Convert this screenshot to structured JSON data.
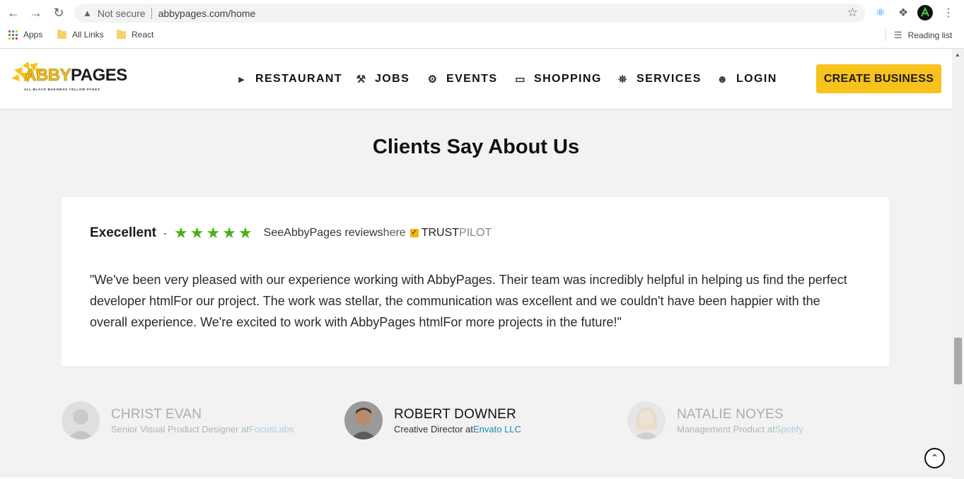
{
  "browser": {
    "security_label": "Not secure",
    "url": "abbypages.com/home",
    "bookmarks": [
      "Apps",
      "All Links",
      "React"
    ],
    "reading_list": "Reading list"
  },
  "brand": {
    "name_part1": "ABBY",
    "name_part2": "PAGES",
    "tagline": "ALL BLACK BUSINESS YELLOW PAGES",
    "accent_color": "#f7c21b"
  },
  "nav": {
    "items": [
      {
        "label": "RESTAURANT",
        "icon": "restaurant-icon"
      },
      {
        "label": "JOBS",
        "icon": "jobs-icon"
      },
      {
        "label": "EVENTS",
        "icon": "events-icon"
      },
      {
        "label": "SHOPPING",
        "icon": "shopping-icon"
      },
      {
        "label": "SERVICES",
        "icon": "services-icon"
      },
      {
        "label": "LOGIN",
        "icon": "user-icon"
      }
    ],
    "cta_label": "CREATE BUSINESS"
  },
  "testimonials": {
    "title": "Clients Say About Us",
    "rating_word": "Execellent",
    "rating_dash": "-",
    "stars": 5,
    "star_color": "#4caf1a",
    "see_prefix": "See",
    "see_brand": "AbbyPages",
    "see_reviews": " reviews",
    "see_here": "here",
    "trustpilot_part1": "TRUST",
    "trustpilot_part2": "PILOT",
    "quote": "\"We've been very pleased with our experience working with AbbyPages. Their team was incredibly helpful in helping us find the perfect developer htmlFor our project. The work was stellar, the communication was excellent and we couldn't have been happier with the overall experience. We're excited to work with AbbyPages htmlFor more projects in the future!\"",
    "people": [
      {
        "name": "CHRIST EVAN",
        "role_prefix": "Senior Visual Product Designer at",
        "company": "FocusLabs",
        "active": false
      },
      {
        "name": "ROBERT DOWNER",
        "role_prefix": "Creative Director at",
        "company": "Envato LLC",
        "active": true
      },
      {
        "name": "NATALIE NOYES",
        "role_prefix": "Management Product at",
        "company": "Spotify",
        "active": false
      }
    ]
  }
}
